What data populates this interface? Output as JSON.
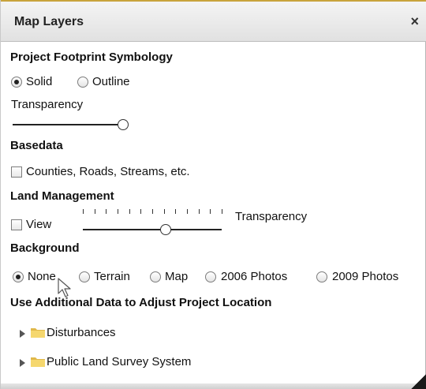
{
  "window": {
    "title": "Map Layers",
    "close_glyph": "×"
  },
  "footprint": {
    "heading": "Project Footprint Symbology",
    "options": [
      "Solid",
      "Outline"
    ],
    "selected": "Solid",
    "transparency_label": "Transparency",
    "transparency_value": 1.0
  },
  "basedata": {
    "heading": "Basedata",
    "checkbox_label": "Counties, Roads, Streams, etc.",
    "checked": false
  },
  "land_management": {
    "heading": "Land Management",
    "view_label": "View",
    "view_checked": false,
    "transparency_label": "Transparency",
    "transparency_value": 0.6
  },
  "background": {
    "heading": "Background",
    "options": [
      "None",
      "Terrain",
      "Map",
      "2006 Photos",
      "2009 Photos"
    ],
    "selected": "None"
  },
  "additional": {
    "heading": "Use Additional Data to Adjust Project Location",
    "items": [
      "Disturbances",
      "Public Land Survey System"
    ]
  },
  "icons": {
    "close": "close-icon",
    "folder": "folder-icon",
    "expand": "expand-arrow-icon",
    "cursor": "mouse-pointer-icon"
  },
  "colors": {
    "folder": "#f5d76e",
    "folder_dark": "#e0b84a",
    "titlebar_border": "#c8a33c"
  }
}
